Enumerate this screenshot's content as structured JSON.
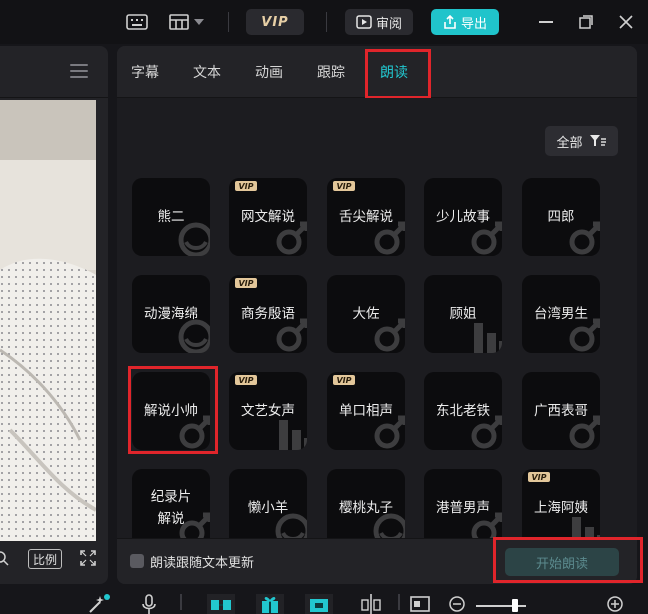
{
  "topbar": {
    "vip_label": "VIP",
    "review_label": "审阅",
    "export_label": "导出",
    "icons": [
      "keyboard-icon",
      "layout-icon",
      "chevron-down-icon",
      "minimize-icon",
      "restore-icon",
      "close-icon"
    ]
  },
  "preview": {
    "ratio_label": "比例",
    "icons": [
      "menu-icon",
      "zoom-icon",
      "fullscreen-icon"
    ]
  },
  "tabs": [
    {
      "label": "字幕",
      "active": false
    },
    {
      "label": "文本",
      "active": false
    },
    {
      "label": "动画",
      "active": false
    },
    {
      "label": "跟踪",
      "active": false
    },
    {
      "label": "朗读",
      "active": true
    }
  ],
  "filter": {
    "label": "全部",
    "icon": "filter-icon"
  },
  "voices": [
    {
      "name": "熊二",
      "vip": false,
      "watermark": "face"
    },
    {
      "name": "网文解说",
      "vip": true,
      "watermark": "male"
    },
    {
      "name": "舌尖解说",
      "vip": true,
      "watermark": "male"
    },
    {
      "name": "少儿故事",
      "vip": false,
      "watermark": "male"
    },
    {
      "name": "四郎",
      "vip": false,
      "watermark": "male"
    },
    {
      "name": "动漫海绵",
      "vip": false,
      "watermark": "face"
    },
    {
      "name": "商务殷语",
      "vip": true,
      "watermark": "male"
    },
    {
      "name": "大佐",
      "vip": false,
      "watermark": "male"
    },
    {
      "name": "顾姐",
      "vip": false,
      "watermark": "female"
    },
    {
      "name": "台湾男生",
      "vip": false,
      "watermark": "male"
    },
    {
      "name": "解说小帅",
      "vip": false,
      "watermark": "male"
    },
    {
      "name": "文艺女声",
      "vip": true,
      "watermark": "female"
    },
    {
      "name": "单口相声",
      "vip": true,
      "watermark": "male"
    },
    {
      "name": "东北老铁",
      "vip": false,
      "watermark": "male"
    },
    {
      "name": "广西表哥",
      "vip": false,
      "watermark": "male"
    },
    {
      "name": "纪录片\n解说",
      "vip": false,
      "watermark": "male"
    },
    {
      "name": "懒小羊",
      "vip": false,
      "watermark": "face"
    },
    {
      "name": "樱桃丸子",
      "vip": false,
      "watermark": "face"
    },
    {
      "name": "港普男声",
      "vip": false,
      "watermark": "male"
    },
    {
      "name": "上海阿姨",
      "vip": true,
      "watermark": "female"
    }
  ],
  "vip_badge": "VIP",
  "footer": {
    "checkbox_label": "朗读跟随文本更新",
    "checkbox_checked": false,
    "start_label": "开始朗读"
  },
  "bottombar": {
    "icons": [
      "magic-icon",
      "mic-icon",
      "link-icon",
      "gift-icon",
      "frame-icon",
      "split-icon",
      "screen-icon",
      "zoom-out-icon",
      "zoom-slider",
      "zoom-in-icon"
    ]
  },
  "colors": {
    "accent": "#22c7cf",
    "highlight": "#e0252b",
    "vip": "#e3c79a",
    "export": "#20c4cb"
  }
}
